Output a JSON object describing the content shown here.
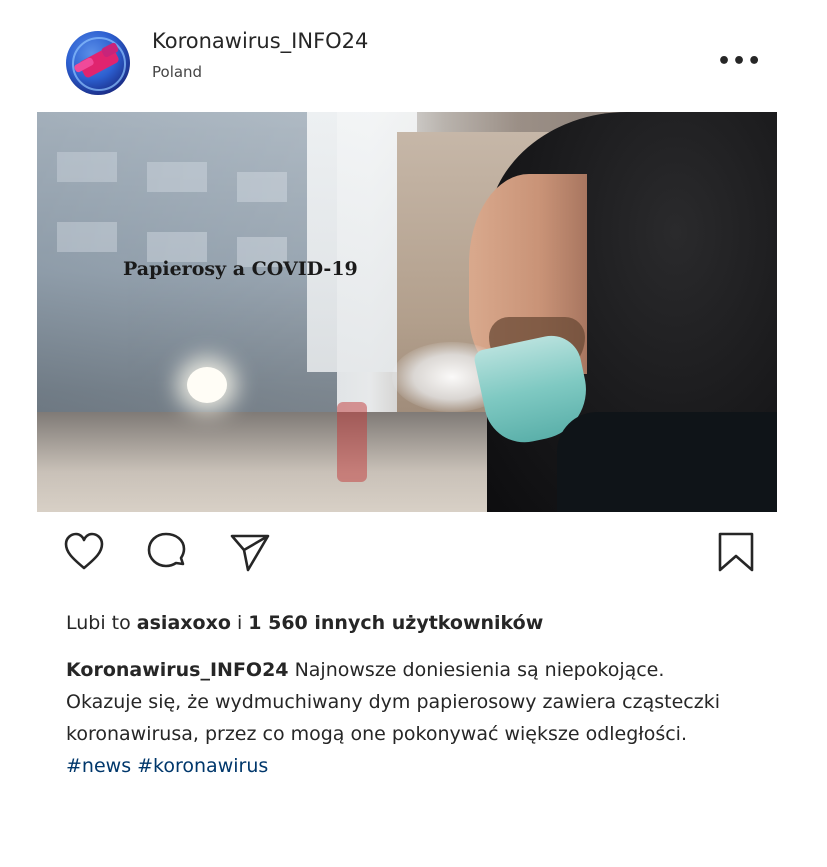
{
  "post": {
    "username": "Koronawirus_INFO24",
    "location": "Poland",
    "more_icon": "more-horizontal-icon",
    "image_overlay_text": "Papierosy a COVID-19",
    "likes": {
      "prefix": "Lubi to",
      "first_user": "asiaxoxo",
      "connector": "i",
      "others": "1 560 innych użytkowników"
    },
    "caption": {
      "author": "Koronawirus_INFO24",
      "text": "Najnowsze doniesienia są niepokojące. Okazuje się, że wydmuchiwany dym papierosowy zawiera cząsteczki koronawirusa, przez co mogą one pokonywać większe odległości.",
      "hashtags": "#news #koronawirus"
    },
    "icons": [
      "heart-icon",
      "comment-icon",
      "share-icon",
      "bookmark-icon"
    ]
  }
}
